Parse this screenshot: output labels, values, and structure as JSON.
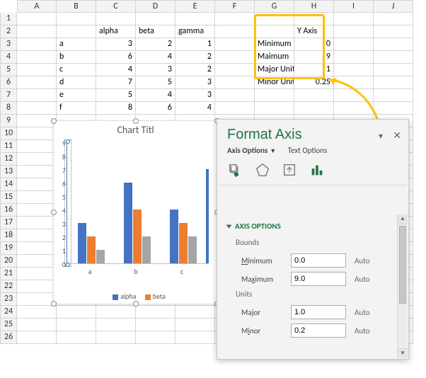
{
  "columns": [
    "A",
    "B",
    "C",
    "D",
    "E",
    "F",
    "G",
    "H",
    "I",
    "J"
  ],
  "row_count": 26,
  "table": {
    "headers": {
      "c": "alpha",
      "d": "beta",
      "e": "gamma"
    },
    "rows": [
      {
        "label": "a",
        "alpha": "3",
        "beta": "2",
        "gamma": "1"
      },
      {
        "label": "b",
        "alpha": "6",
        "beta": "4",
        "gamma": "2"
      },
      {
        "label": "c",
        "alpha": "4",
        "beta": "3",
        "gamma": "2"
      },
      {
        "label": "d",
        "alpha": "7",
        "beta": "5",
        "gamma": "3"
      },
      {
        "label": "e",
        "alpha": "5",
        "beta": "4",
        "gamma": "3"
      },
      {
        "label": "f",
        "alpha": "8",
        "beta": "6",
        "gamma": "4"
      }
    ]
  },
  "axis_config": {
    "title": "Y Axis",
    "rows": [
      {
        "label": "Minimum",
        "value": "0"
      },
      {
        "label": "Maimum",
        "value": "9"
      },
      {
        "label": "Major Unit",
        "value": "1"
      },
      {
        "label": "Minor Unit",
        "value": "0.25"
      }
    ]
  },
  "chart": {
    "title": "Chart Titl",
    "y_ticks": [
      "9",
      "8",
      "7",
      "6",
      "5",
      "4",
      "3",
      "2",
      "1",
      "0"
    ],
    "x_ticks": [
      "a",
      "b",
      "c"
    ],
    "legend": [
      "alpha",
      "beta"
    ]
  },
  "chart_data": {
    "type": "bar",
    "title": "Chart Title",
    "categories": [
      "a",
      "b",
      "c",
      "d",
      "e",
      "f"
    ],
    "series": [
      {
        "name": "alpha",
        "values": [
          3,
          6,
          4,
          7,
          5,
          8
        ]
      },
      {
        "name": "beta",
        "values": [
          2,
          4,
          3,
          5,
          4,
          6
        ]
      },
      {
        "name": "gamma",
        "values": [
          1,
          2,
          2,
          3,
          3,
          4
        ]
      }
    ],
    "visible_categories": [
      "a",
      "b",
      "c"
    ],
    "xlabel": "",
    "ylabel": "",
    "ylim": [
      0,
      9
    ],
    "y_major_unit": 1
  },
  "pane": {
    "title": "Format Axis",
    "tab_axis": "Axis Options",
    "tab_text": "Text Options",
    "section": "Axis Options",
    "group_bounds": "Bounds",
    "group_units": "Units",
    "min_label": "Minimum",
    "min_value": "0.0",
    "max_label": "Maximum",
    "max_value": "9.0",
    "major_label": "Major",
    "major_value": "1.0",
    "minor_label": "Minor",
    "minor_value": "0.2",
    "auto": "Auto"
  }
}
